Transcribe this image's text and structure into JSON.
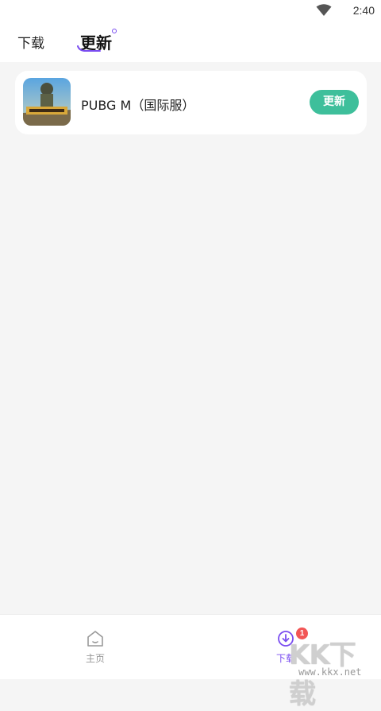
{
  "status_bar": {
    "time": "2:40",
    "wifi_icon": "wifi-icon"
  },
  "tabs": {
    "download": "下载",
    "update": "更新"
  },
  "update_list": [
    {
      "name": "PUBG M（国际服）",
      "icon": "pubg-icon",
      "action": "更新"
    }
  ],
  "bottom_nav": {
    "home": {
      "label": "主页",
      "icon": "home-icon"
    },
    "download": {
      "label": "下载",
      "icon": "download-icon",
      "badge": "1"
    }
  },
  "watermark": {
    "main": "KK下载",
    "url": "www.kkx.net"
  },
  "colors": {
    "accent": "#7a4df0",
    "button": "#3ebf9b",
    "badge": "#f25555",
    "background": "#f5f5f5"
  }
}
